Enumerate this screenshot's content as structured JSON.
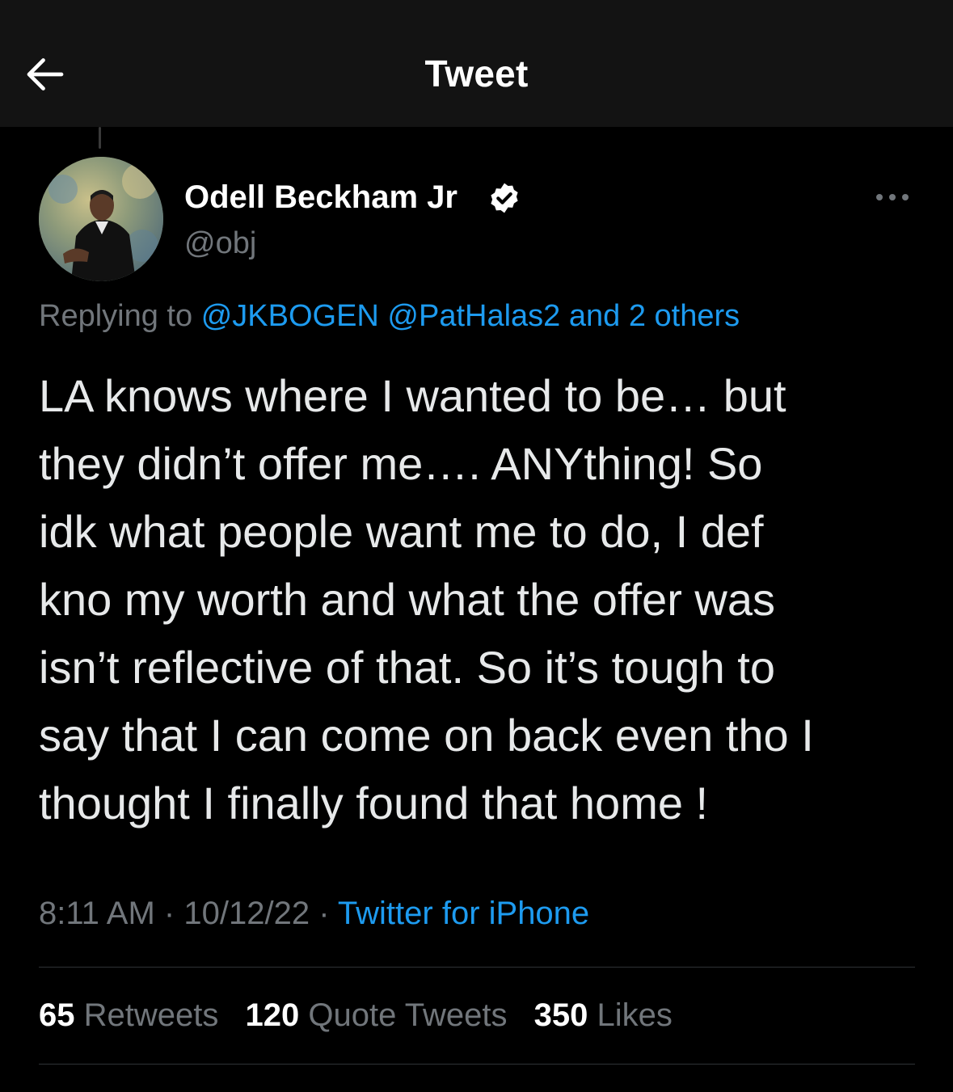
{
  "header": {
    "title": "Tweet",
    "back_icon": "arrow-left-icon"
  },
  "author": {
    "display_name": "Odell Beckham Jr",
    "handle": "@obj",
    "verified": true,
    "verified_icon": "verified-badge-icon",
    "more_icon": "more-horizontal-icon"
  },
  "replying": {
    "prefix": "Replying to",
    "mention1": "@JKBOGEN",
    "mention2": "@PatHalas2",
    "others": "and 2 others"
  },
  "tweet": {
    "text": "LA knows where I wanted to be… but\nthey didn’t offer me…. ANYthing! So\nidk what people want me to do, I def\nkno my worth and what the offer was\nisn’t reflective of that. So it’s tough to\nsay that I can come on back even tho I\nthought I finally found that home !"
  },
  "meta": {
    "time": "8:11 AM",
    "date": "10/12/22",
    "separator": "·",
    "source": "Twitter for iPhone"
  },
  "stats": {
    "retweets_count": "65",
    "retweets_label": "Retweets",
    "quotes_count": "120",
    "quotes_label": "Quote Tweets",
    "likes_count": "350",
    "likes_label": "Likes"
  },
  "colors": {
    "background": "#000000",
    "header_bg": "#131313",
    "text": "#e7e9ea",
    "muted": "#71767b",
    "link": "#1d9bf0",
    "divider": "#2f3336"
  }
}
